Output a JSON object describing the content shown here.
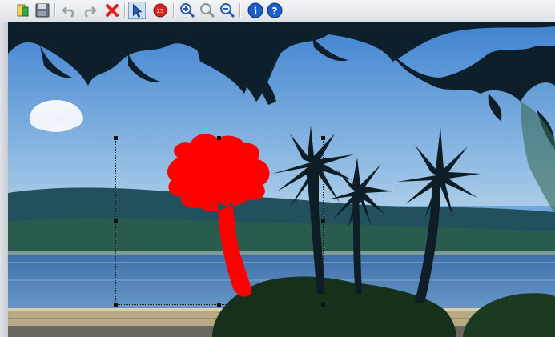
{
  "toolbar": {
    "buttons": [
      {
        "name": "open",
        "icon": "open-folder-icon"
      },
      {
        "name": "save",
        "icon": "floppy-disk-icon"
      },
      {
        "name": "undo",
        "icon": "undo-arrow-icon"
      },
      {
        "name": "redo",
        "icon": "redo-arrow-icon"
      },
      {
        "name": "delete",
        "icon": "red-x-icon"
      },
      {
        "name": "select",
        "icon": "cursor-arrow-icon"
      },
      {
        "name": "stamp",
        "icon": "red-stamp-icon",
        "label": "25"
      },
      {
        "name": "zoom-in",
        "icon": "zoom-in-icon"
      },
      {
        "name": "zoom-fit",
        "icon": "zoom-fit-icon"
      },
      {
        "name": "zoom-out",
        "icon": "zoom-out-icon"
      },
      {
        "name": "info",
        "icon": "info-icon",
        "label": "i"
      },
      {
        "name": "help",
        "icon": "help-icon",
        "label": "?"
      }
    ]
  },
  "colors": {
    "sky": "#6fa8dc",
    "water": "#4f7fb5",
    "hills": "#1f4a57",
    "annotation": "#ff0000",
    "foliage": "#0d1f2a"
  }
}
